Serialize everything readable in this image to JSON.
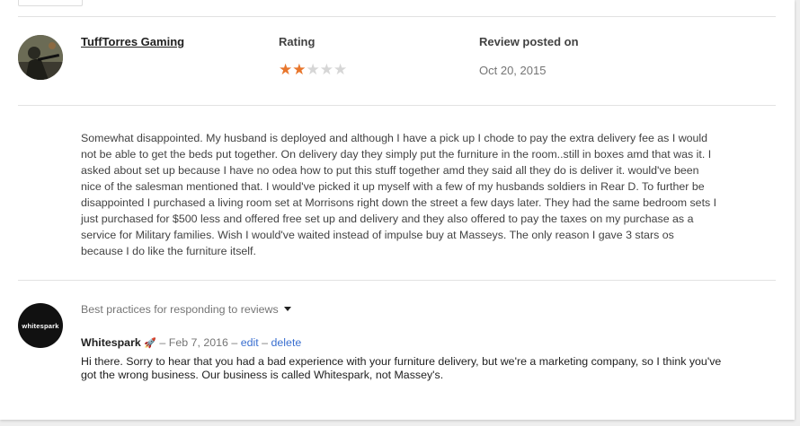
{
  "review": {
    "reviewer_name": "TuffTorres Gaming",
    "rating_header": "Rating",
    "rating_value": 2,
    "rating_max": 5,
    "stars": [
      "★",
      "★",
      "★",
      "★",
      "★"
    ],
    "posted_header": "Review posted on",
    "posted_date": "Oct 20, 2015",
    "text": "Somewhat disappointed. My husband is deployed and although I have a pick up I chode to pay the extra delivery fee as I would not be able to get the beds put together. On delivery day they simply put the furniture in the room..still in boxes amd that was it. I asked about set up because I have no odea how to put this stuff together amd they said all they do is deliver it. would've been nice of the salesman mentioned that. I would've picked it up myself with a few of my husbands soldiers in Rear D. To further be disappointed I purchased a living room set at Morrisons right down the street a few days later. They had the same bedroom sets I just purchased for $500 less and offered free set up and delivery and they also offered to pay the taxes on my purchase as a service for Military families. Wish I would've waited instead of impulse buy at Masseys. The only reason I gave 3 stars os because I do like the furniture itself."
  },
  "reply": {
    "logo_text": "whitespark",
    "best_practices_label": "Best practices for responding to reviews",
    "owner_name": "Whitespark",
    "owner_badge": "🚀",
    "separator": "–",
    "date": "Feb 7, 2016",
    "edit_label": "edit",
    "delete_label": "delete",
    "text": "Hi there. Sorry to hear that you had a bad experience with your furniture delivery, but we're a marketing company, so I think you've got the wrong business. Our business is called Whitespark, not Massey's."
  },
  "colors": {
    "star_active": "#e8762c",
    "star_inactive": "#d6d6d6",
    "link": "#3a6fd0"
  }
}
